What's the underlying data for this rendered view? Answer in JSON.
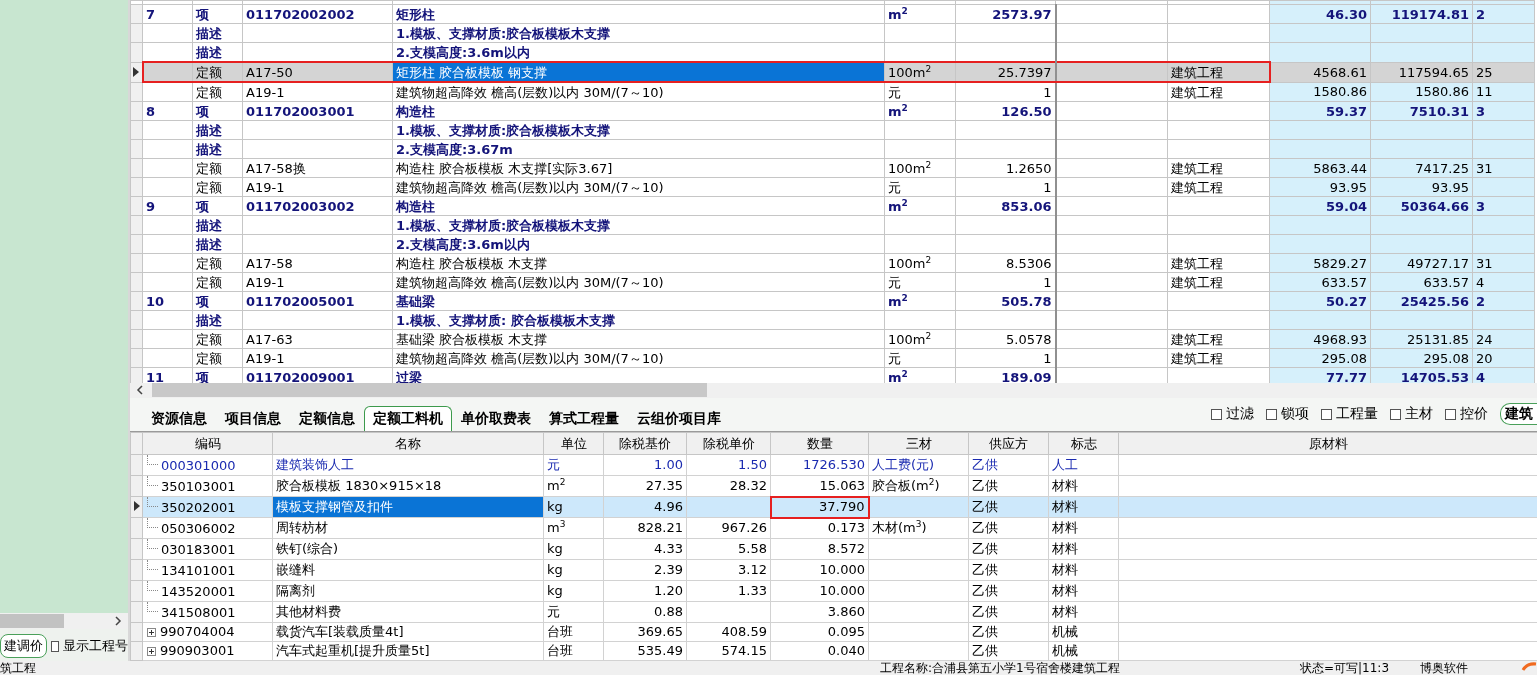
{
  "left_panel": {
    "button": "建调价",
    "checkbox": {
      "label": "显示工程号",
      "checked": false
    }
  },
  "top_table": {
    "rows": [
      {
        "kind": "item",
        "number": "7",
        "type": "项",
        "code": "011702002002",
        "name": "矩形柱",
        "unit": "m$^{2}$",
        "quantity": "2573.97",
        "unit_price": "46.30",
        "total": "119174.81",
        "column_11": "2",
        "selected": false,
        "highlighted": false
      },
      {
        "kind": "desc",
        "type": "描述",
        "name": "1.模板、支撑材质:胶合板模板木支撑",
        "selected": false,
        "highlighted": false
      },
      {
        "kind": "desc",
        "type": "描述",
        "name": "2.支模高度:3.6m以内",
        "selected": false,
        "highlighted": false
      },
      {
        "kind": "quota",
        "type": "定额",
        "code": "A17-50",
        "name": "矩形柱 胶合板模板 钢支撑",
        "unit": "100m$^{2}$",
        "quantity": "25.7397",
        "specialty": "建筑工程",
        "unit_price": "4568.61",
        "total": "117594.65",
        "column_11": "25",
        "selected": true,
        "highlighted": true
      },
      {
        "kind": "quota",
        "type": "定额",
        "code": "A19-1",
        "name": "建筑物超高降效 檐高(层数)以内 30M/(7～10)",
        "unit": "元",
        "quantity": "1",
        "specialty": "建筑工程",
        "unit_price": "1580.86",
        "total": "1580.86",
        "column_11": "11",
        "selected": false,
        "highlighted": false
      },
      {
        "kind": "item",
        "number": "8",
        "type": "项",
        "code": "011702003001",
        "name": "构造柱",
        "unit": "m$^{2}$",
        "quantity": "126.50",
        "unit_price": "59.37",
        "total": "7510.31",
        "column_11": "3",
        "selected": false,
        "highlighted": false
      },
      {
        "kind": "desc",
        "type": "描述",
        "name": "1.模板、支撑材质:胶合板模板木支撑",
        "selected": false,
        "highlighted": false
      },
      {
        "kind": "desc",
        "type": "描述",
        "name": "2.支模高度:3.67m",
        "selected": false,
        "highlighted": false
      },
      {
        "kind": "quota",
        "type": "定额",
        "code": "A17-58换",
        "name": "构造柱 胶合板模板 木支撑[实际3.67]",
        "unit": "100m$^{2}$",
        "quantity": "1.2650",
        "specialty": "建筑工程",
        "unit_price": "5863.44",
        "total": "7417.25",
        "column_11": "31",
        "selected": false,
        "highlighted": false
      },
      {
        "kind": "quota",
        "type": "定额",
        "code": "A19-1",
        "name": "建筑物超高降效 檐高(层数)以内 30M/(7～10)",
        "unit": "元",
        "quantity": "1",
        "specialty": "建筑工程",
        "unit_price": "93.95",
        "total": "93.95",
        "selected": false,
        "highlighted": false
      },
      {
        "kind": "item",
        "number": "9",
        "type": "项",
        "code": "011702003002",
        "name": "构造柱",
        "unit": "m$^{2}$",
        "quantity": "853.06",
        "unit_price": "59.04",
        "total": "50364.66",
        "column_11": "3",
        "selected": false,
        "highlighted": false
      },
      {
        "kind": "desc",
        "type": "描述",
        "name": "1.模板、支撑材质:胶合板模板木支撑",
        "selected": false,
        "highlighted": false
      },
      {
        "kind": "desc",
        "type": "描述",
        "name": "2.支模高度:3.6m以内",
        "selected": false,
        "highlighted": false
      },
      {
        "kind": "quota",
        "type": "定额",
        "code": "A17-58",
        "name": "构造柱 胶合板模板 木支撑",
        "unit": "100m$^{2}$",
        "quantity": "8.5306",
        "specialty": "建筑工程",
        "unit_price": "5829.27",
        "total": "49727.17",
        "column_11": "31",
        "selected": false,
        "highlighted": false
      },
      {
        "kind": "quota",
        "type": "定额",
        "code": "A19-1",
        "name": "建筑物超高降效 檐高(层数)以内 30M/(7～10)",
        "unit": "元",
        "quantity": "1",
        "specialty": "建筑工程",
        "unit_price": "633.57",
        "total": "633.57",
        "column_11": "4",
        "selected": false,
        "highlighted": false
      },
      {
        "kind": "item",
        "number": "10",
        "type": "项",
        "code": "011702005001",
        "name": "基础梁",
        "unit": "m$^{2}$",
        "quantity": "505.78",
        "unit_price": "50.27",
        "total": "25425.56",
        "column_11": "2",
        "selected": false,
        "highlighted": false
      },
      {
        "kind": "desc",
        "type": "描述",
        "name": "1.模板、支撑材质: 胶合板模板木支撑",
        "selected": false,
        "highlighted": false
      },
      {
        "kind": "quota",
        "type": "定额",
        "code": "A17-63",
        "name": "基础梁 胶合板模板 木支撑",
        "unit": "100m$^{2}$",
        "quantity": "5.0578",
        "specialty": "建筑工程",
        "unit_price": "4968.93",
        "total": "25131.85",
        "column_11": "24",
        "selected": false,
        "highlighted": false
      },
      {
        "kind": "quota",
        "type": "定额",
        "code": "A19-1",
        "name": "建筑物超高降效 檐高(层数)以内 30M/(7～10)",
        "unit": "元",
        "quantity": "1",
        "specialty": "建筑工程",
        "unit_price": "295.08",
        "total": "295.08",
        "column_11": "20",
        "selected": false,
        "highlighted": false
      },
      {
        "kind": "item",
        "number": "11",
        "type": "项",
        "code": "011702009001",
        "name": "过梁",
        "unit": "m$^{2}$",
        "quantity": "189.09",
        "unit_price": "77.77",
        "total": "14705.53",
        "column_11": "4",
        "selected": false,
        "highlighted": false
      }
    ]
  },
  "tabs": [
    {
      "label": "资源信息",
      "selected": false
    },
    {
      "label": "项目信息",
      "selected": false
    },
    {
      "label": "定额信息",
      "selected": false
    },
    {
      "label": "定额工料机",
      "selected": true
    },
    {
      "label": "单价取费表",
      "selected": false
    },
    {
      "label": "算式工程量",
      "selected": false
    },
    {
      "label": "云组价项目库",
      "selected": false
    }
  ],
  "filters": [
    {
      "label": "过滤",
      "checked": false
    },
    {
      "label": "锁项",
      "checked": false
    },
    {
      "label": "工程量",
      "checked": false
    },
    {
      "label": "主材",
      "checked": false
    },
    {
      "label": "控价",
      "checked": false
    }
  ],
  "filter_button": "建筑",
  "resource_table": {
    "columns": [
      "编码",
      "名称",
      "单位",
      "除税基价",
      "除税单价",
      "数量",
      "三材",
      "供应方",
      "标志",
      "原材料"
    ],
    "rows": [
      {
        "kind": "labor",
        "expandable": false,
        "selected": false,
        "highlighted": false,
        "code": "000301000",
        "name": "建筑装饰人工",
        "unit": "元",
        "base_price": "1.00",
        "price": "1.50",
        "quantity": "1726.530",
        "material_class": "人工费(元)",
        "supplier": "乙供",
        "flag": "人工"
      },
      {
        "kind": "material",
        "expandable": false,
        "selected": false,
        "highlighted": false,
        "code": "350103001",
        "name": "胶合板模板 1830×915×18",
        "unit": "m$^{2}$",
        "base_price": "27.35",
        "price": "28.32",
        "quantity": "15.063",
        "material_class": "胶合板(m$^{2}$)",
        "supplier": "乙供",
        "flag": "材料"
      },
      {
        "kind": "material",
        "expandable": false,
        "selected": true,
        "highlighted": true,
        "code": "350202001",
        "name": "模板支撑钢管及扣件",
        "unit": "kg",
        "base_price": "4.96",
        "quantity": "37.790",
        "supplier": "乙供",
        "flag": "材料"
      },
      {
        "kind": "material",
        "expandable": false,
        "selected": false,
        "highlighted": false,
        "code": "050306002",
        "name": "周转枋材",
        "unit": "m$^{3}$",
        "base_price": "828.21",
        "price": "967.26",
        "quantity": "0.173",
        "material_class": "木材(m$^{3}$)",
        "supplier": "乙供",
        "flag": "材料"
      },
      {
        "kind": "material",
        "expandable": false,
        "selected": false,
        "highlighted": false,
        "code": "030183001",
        "name": "铁钉(综合)",
        "unit": "kg",
        "base_price": "4.33",
        "price": "5.58",
        "quantity": "8.572",
        "supplier": "乙供",
        "flag": "材料"
      },
      {
        "kind": "material",
        "expandable": false,
        "selected": false,
        "highlighted": false,
        "code": "134101001",
        "name": "嵌缝料",
        "unit": "kg",
        "base_price": "2.39",
        "price": "3.12",
        "quantity": "10.000",
        "supplier": "乙供",
        "flag": "材料"
      },
      {
        "kind": "material",
        "expandable": false,
        "selected": false,
        "highlighted": false,
        "code": "143520001",
        "name": "隔离剂",
        "unit": "kg",
        "base_price": "1.20",
        "price": "1.33",
        "quantity": "10.000",
        "supplier": "乙供",
        "flag": "材料"
      },
      {
        "kind": "material",
        "expandable": false,
        "selected": false,
        "highlighted": false,
        "code": "341508001",
        "name": "其他材料费",
        "unit": "元",
        "base_price": "0.88",
        "quantity": "3.860",
        "supplier": "乙供",
        "flag": "材料"
      },
      {
        "kind": "machine",
        "expandable": true,
        "selected": false,
        "highlighted": false,
        "code": "990704004",
        "name": "载货汽车[装载质量4t]",
        "unit": "台班",
        "base_price": "369.65",
        "price": "408.59",
        "quantity": "0.095",
        "supplier": "乙供",
        "flag": "机械"
      },
      {
        "kind": "machine",
        "expandable": true,
        "selected": false,
        "highlighted": false,
        "code": "990903001",
        "name": "汽车式起重机[提升质量5t]",
        "unit": "台班",
        "base_price": "535.49",
        "price": "574.15",
        "quantity": "0.040",
        "supplier": "乙供",
        "flag": "机械"
      }
    ]
  },
  "status_bar": {
    "left": "筑工程",
    "project": "工程名称:合浦县第五小学1号宿舍楼建筑工程",
    "state": "状态=可写|11:3",
    "vendor": "博奥软件"
  }
}
